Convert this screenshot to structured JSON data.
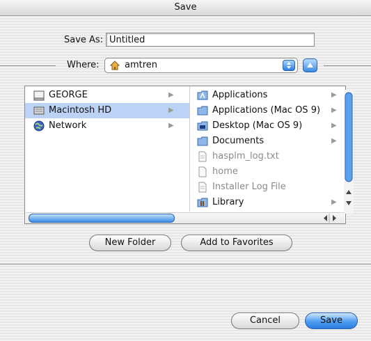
{
  "window": {
    "title": "Save"
  },
  "save_as": {
    "label": "Save As:",
    "value": "Untitled"
  },
  "where": {
    "label": "Where:",
    "selected": "amtren"
  },
  "sidebar": {
    "items": [
      {
        "label": "GEORGE",
        "icon": "drive-icon"
      },
      {
        "label": "Macintosh HD",
        "icon": "hard-disk-icon",
        "selected": true
      },
      {
        "label": "Network",
        "icon": "network-globe-icon"
      }
    ]
  },
  "files": {
    "items": [
      {
        "label": "Applications",
        "icon": "applications-folder-icon",
        "folder": true
      },
      {
        "label": "Applications (Mac OS 9)",
        "icon": "folder-icon",
        "folder": true
      },
      {
        "label": "Desktop (Mac OS 9)",
        "icon": "desktop-folder-icon",
        "folder": true
      },
      {
        "label": "Documents",
        "icon": "folder-icon",
        "folder": true
      },
      {
        "label": "hasplm_log.txt",
        "icon": "document-icon",
        "folder": false
      },
      {
        "label": "home",
        "icon": "document-icon",
        "folder": false
      },
      {
        "label": "Installer Log File",
        "icon": "document-icon",
        "folder": false
      },
      {
        "label": "Library",
        "icon": "library-folder-icon",
        "folder": true
      }
    ]
  },
  "buttons": {
    "new_folder": "New Folder",
    "add_favorites": "Add to Favorites",
    "cancel": "Cancel",
    "save": "Save"
  },
  "colors": {
    "accent": "#3a8ae6",
    "selection": "#bcd3f5"
  }
}
